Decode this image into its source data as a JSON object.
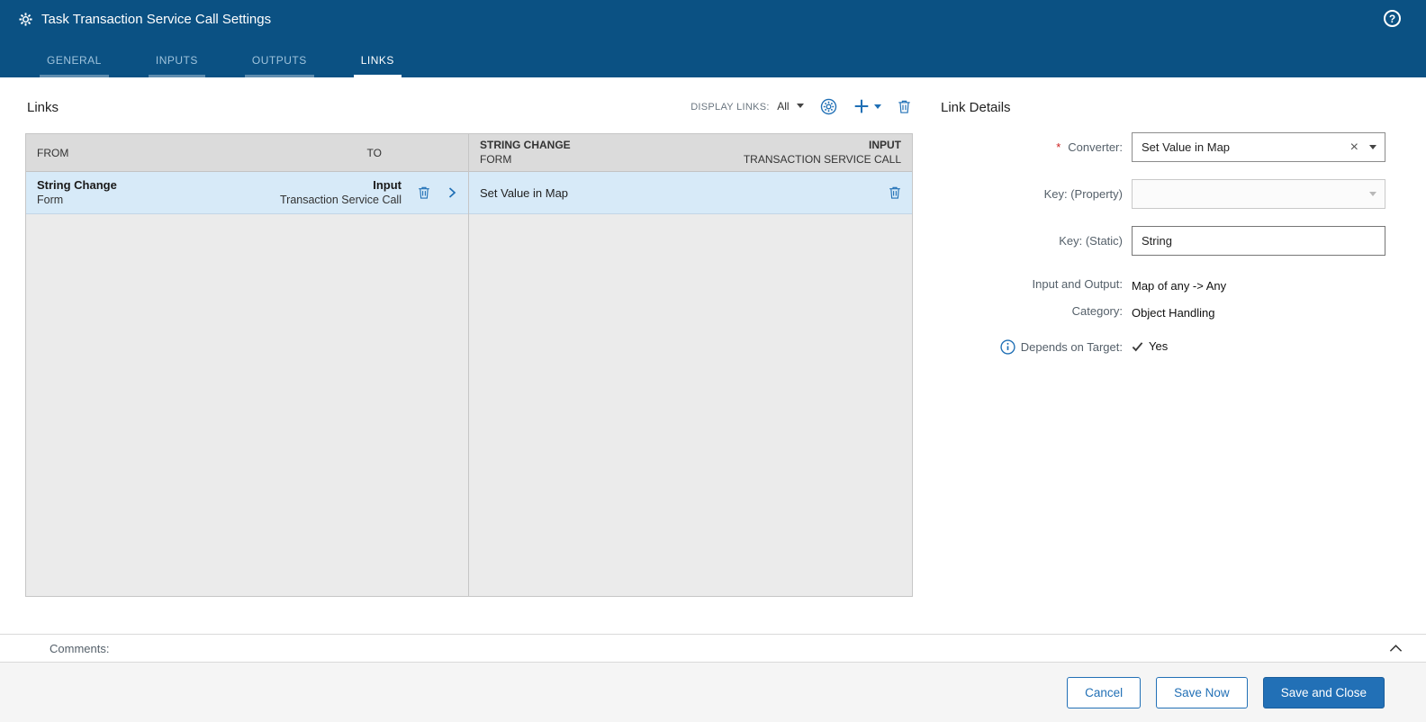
{
  "window": {
    "title": "Task Transaction Service Call Settings",
    "help_glyph": "?"
  },
  "tabs": [
    {
      "label": "GENERAL",
      "active": false
    },
    {
      "label": "INPUTS",
      "active": false
    },
    {
      "label": "OUTPUTS",
      "active": false
    },
    {
      "label": "LINKS",
      "active": true
    }
  ],
  "links_panel": {
    "title": "Links",
    "toolbar": {
      "display_links_label": "DISPLAY LINKS:",
      "display_links_value": "All"
    },
    "link_table": {
      "col_from": "FROM",
      "col_to": "TO",
      "rows": [
        {
          "from_name": "String Change",
          "from_detail": "Form",
          "to_name": "Input",
          "to_detail": "Transaction Service Call"
        }
      ]
    },
    "converter_table": {
      "header_from_name": "STRING CHANGE",
      "header_from_detail": "FORM",
      "header_to_name": "INPUT",
      "header_to_detail": "TRANSACTION SERVICE CALL",
      "rows": [
        {
          "converter": "Set Value in Map"
        }
      ]
    }
  },
  "link_details": {
    "title": "Link Details",
    "converter_label": "Converter:",
    "converter_value": "Set Value in Map",
    "key_property_label": "Key: (Property)",
    "key_property_value": "",
    "key_static_label": "Key: (Static)",
    "key_static_value": "String",
    "input_output_label": "Input and Output:",
    "input_output_value": "Map of any -> Any",
    "category_label": "Category:",
    "category_value": "Object Handling",
    "depends_label": "Depends on Target:",
    "depends_value": "Yes"
  },
  "comments": {
    "label": "Comments:"
  },
  "footer": {
    "cancel_label": "Cancel",
    "save_now_label": "Save Now",
    "save_close_label": "Save and Close"
  },
  "colors": {
    "header_bg": "#0B5183",
    "accent_blue": "#2270B6",
    "selected_row_bg": "#D7EAF8",
    "table_header_bg": "#DBDBDB",
    "required_red": "#CC1F1F"
  }
}
